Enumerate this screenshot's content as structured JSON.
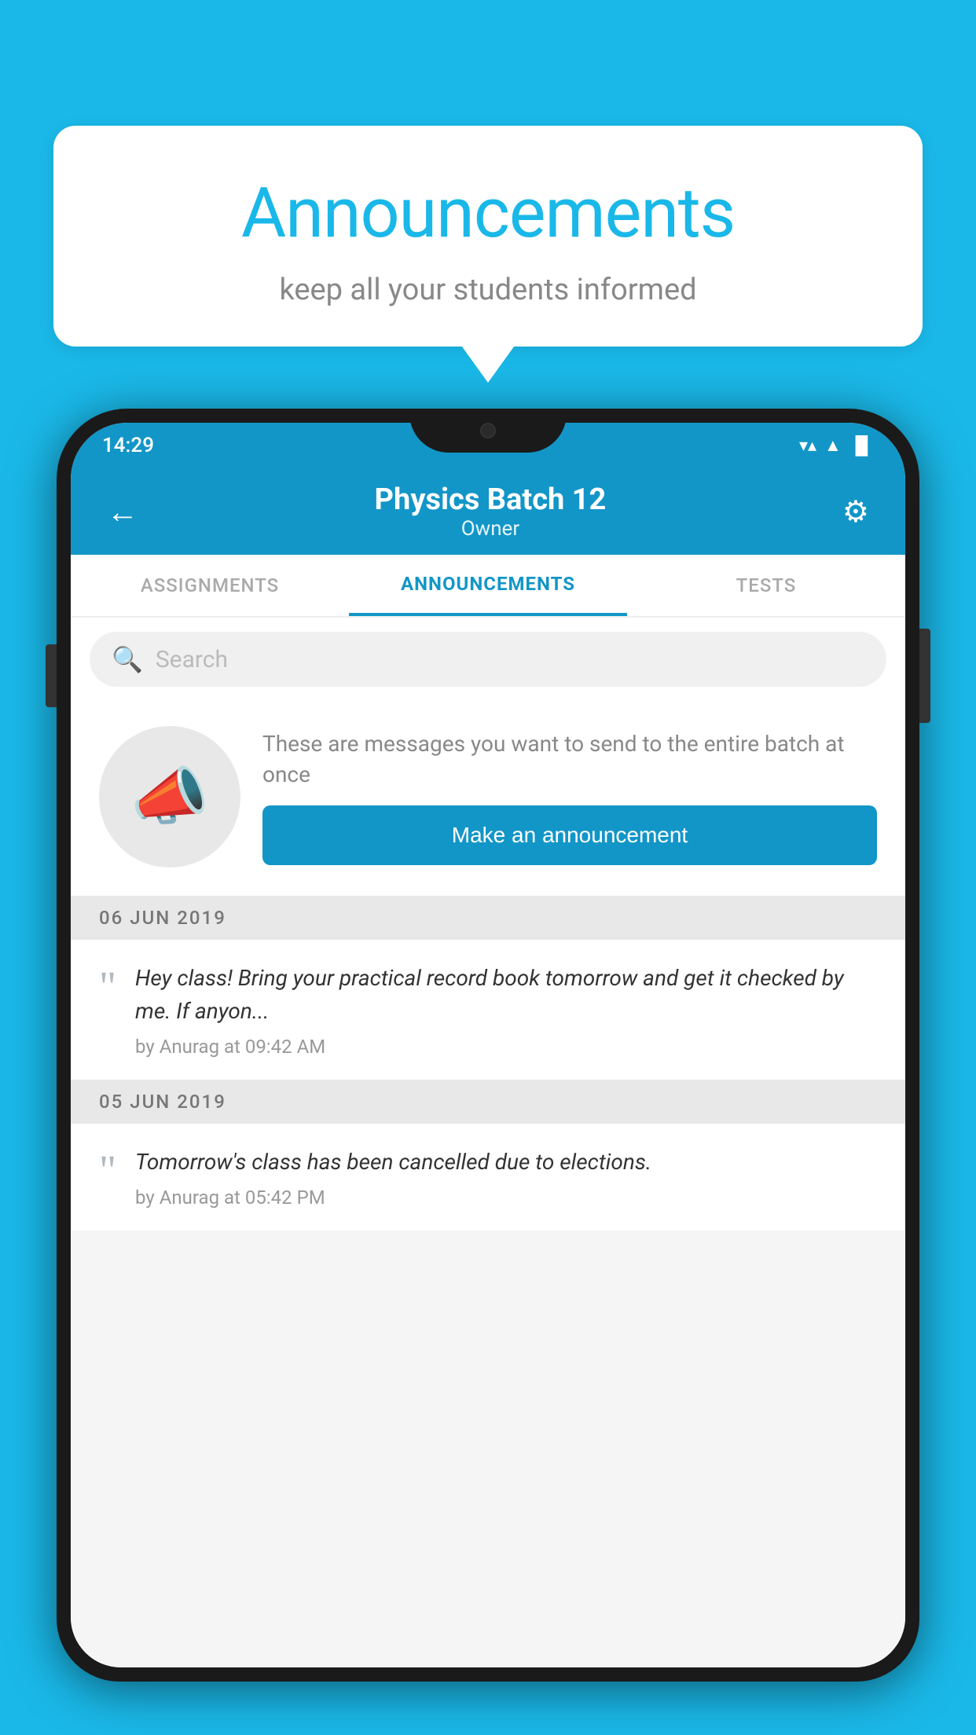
{
  "background_color": "#1ab8e8",
  "speech_bubble": {
    "title": "Announcements",
    "subtitle": "keep all your students informed"
  },
  "phone": {
    "status_bar": {
      "time": "14:29",
      "wifi": "▼",
      "signal": "▲",
      "battery": "▐"
    },
    "app_bar": {
      "back_label": "←",
      "title": "Physics Batch 12",
      "subtitle": "Owner",
      "settings_label": "⚙"
    },
    "tabs": [
      {
        "label": "ASSIGNMENTS",
        "active": false
      },
      {
        "label": "ANNOUNCEMENTS",
        "active": true
      },
      {
        "label": "TESTS",
        "active": false
      }
    ],
    "search": {
      "placeholder": "Search"
    },
    "promo": {
      "description": "These are messages you want to send to the entire batch at once",
      "button_label": "Make an announcement"
    },
    "announcements": [
      {
        "date": "06  JUN  2019",
        "text": "Hey class! Bring your practical record book tomorrow and get it checked by me. If anyon...",
        "meta": "by Anurag at 09:42 AM"
      },
      {
        "date": "05  JUN  2019",
        "text": "Tomorrow's class has been cancelled due to elections.",
        "meta": "by Anurag at 05:42 PM"
      }
    ]
  }
}
